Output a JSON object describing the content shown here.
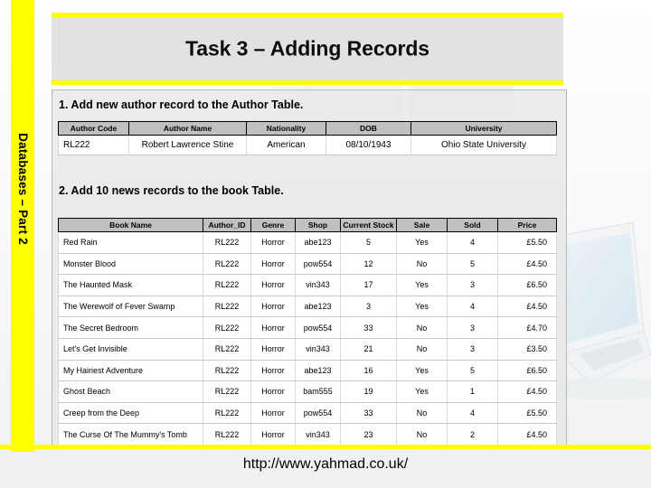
{
  "slide": {
    "title": "Task 3 – Adding Records",
    "side_tab_label": "Databases – Part 2",
    "footer_url": "http://www.yahmad.co.uk/",
    "accent_color": "#ffff00",
    "title_panel_color": "#e2e2e2",
    "table_header_color": "#c0c0c0"
  },
  "task1": {
    "heading": "1. Add new author record to the Author Table.",
    "table": {
      "headers": [
        "Author Code",
        "Author Name",
        "Nationality",
        "DOB",
        "University"
      ],
      "rows": [
        [
          "RL222",
          "Robert Lawrence Stine",
          "American",
          "08/10/1943",
          "Ohio State University"
        ]
      ]
    }
  },
  "task2": {
    "heading": "2. Add 10 news records to the book Table.",
    "table": {
      "headers": [
        "Book Name",
        "Author_ID",
        "Genre",
        "Shop",
        "Current Stock",
        "Sale",
        "Sold",
        "Price"
      ],
      "rows": [
        [
          "Red Rain",
          "RL222",
          "Horror",
          "abe123",
          "5",
          "Yes",
          "4",
          "£5.50"
        ],
        [
          "Monster Blood",
          "RL222",
          "Horror",
          "pow554",
          "12",
          "No",
          "5",
          "£4.50"
        ],
        [
          "The Haunted Mask",
          "RL222",
          "Horror",
          "vin343",
          "17",
          "Yes",
          "3",
          "£6.50"
        ],
        [
          "The Werewolf of Fever Swamp",
          "RL222",
          "Horror",
          "abe123",
          "3",
          "Yes",
          "4",
          "£4.50"
        ],
        [
          "The Secret Bedroom",
          "RL222",
          "Horror",
          "pow554",
          "33",
          "No",
          "3",
          "£4.70"
        ],
        [
          "Let's Get Invisible",
          "RL222",
          "Horror",
          "vin343",
          "21",
          "No",
          "3",
          "£3.50"
        ],
        [
          "My Hairiest Adventure",
          "RL222",
          "Horror",
          "abe123",
          "16",
          "Yes",
          "5",
          "£6.50"
        ],
        [
          "Ghost Beach",
          "RL222",
          "Horror",
          "bam555",
          "19",
          "Yes",
          "1",
          "£4.50"
        ],
        [
          "Creep from the Deep",
          "RL222",
          "Horror",
          "pow554",
          "33",
          "No",
          "4",
          "£5.50"
        ],
        [
          "The Curse Of The Mummy's Tomb",
          "RL222",
          "Horror",
          "vin343",
          "23",
          "No",
          "2",
          "£4.50"
        ]
      ]
    }
  }
}
